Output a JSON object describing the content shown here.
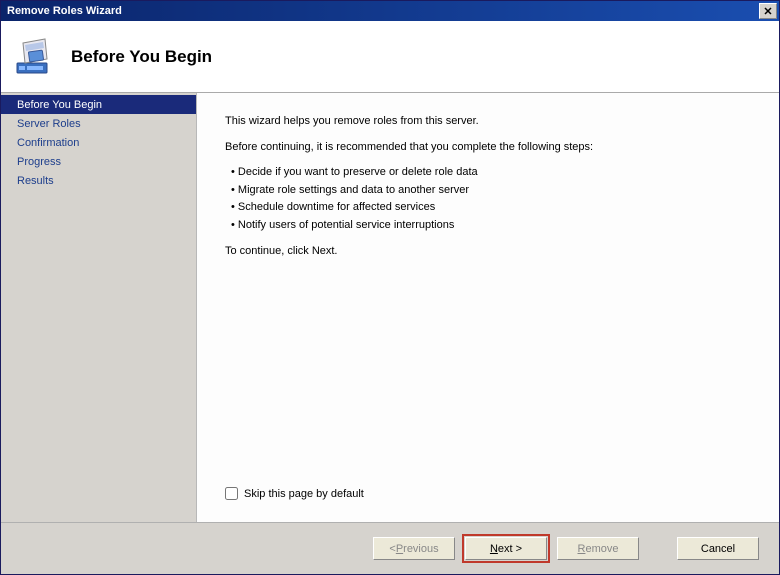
{
  "window": {
    "title": "Remove Roles Wizard"
  },
  "header": {
    "title": "Before You Begin"
  },
  "sidebar": {
    "items": [
      {
        "label": "Before You Begin",
        "active": true
      },
      {
        "label": "Server Roles",
        "active": false
      },
      {
        "label": "Confirmation",
        "active": false
      },
      {
        "label": "Progress",
        "active": false
      },
      {
        "label": "Results",
        "active": false
      }
    ]
  },
  "content": {
    "intro": "This wizard helps you remove roles from this server.",
    "recommend": "Before continuing, it is recommended that you complete the following steps:",
    "bullets": [
      "Decide if you want to preserve or delete role data",
      "Migrate role settings and data to another server",
      "Schedule downtime for affected services",
      "Notify users of potential service interruptions"
    ],
    "continue": "To continue, click Next.",
    "skip_label": "Skip this page by default"
  },
  "footer": {
    "previous": "< Previous",
    "next": "Next >",
    "remove": "Remove",
    "cancel": "Cancel"
  }
}
